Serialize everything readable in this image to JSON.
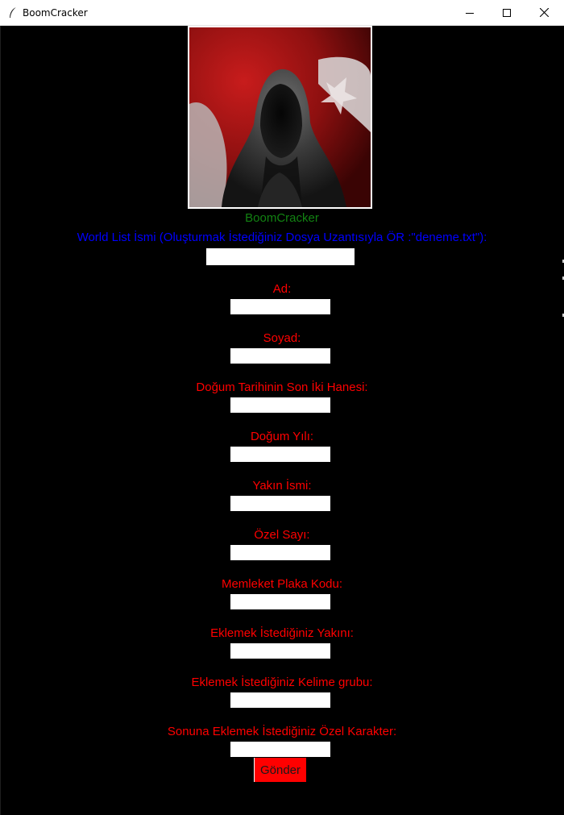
{
  "window": {
    "title": "BoomCracker",
    "icon": "feather-icon"
  },
  "app_name": "BoomCracker",
  "wordlist": {
    "label": "World List İsmi (Oluşturmak İstediğiniz Dosya Uzantısıyla ÖR :\"deneme.txt\"):",
    "value": ""
  },
  "fields": [
    {
      "label": "Ad:",
      "value": ""
    },
    {
      "label": "Soyad:",
      "value": ""
    },
    {
      "label": "Doğum Tarihinin Son İki Hanesi:",
      "value": ""
    },
    {
      "label": "Doğum Yılı:",
      "value": ""
    },
    {
      "label": "Yakın İsmi:",
      "value": ""
    },
    {
      "label": "Özel Sayı:",
      "value": ""
    },
    {
      "label": "Memleket Plaka Kodu:",
      "value": ""
    },
    {
      "label": "Eklemek İstediğiniz Yakını:",
      "value": ""
    },
    {
      "label": "Eklemek İstediğiniz Kelime grubu:",
      "value": ""
    },
    {
      "label": "Sonuna Eklemek İstediğiniz Özel Karakter:",
      "value": ""
    }
  ],
  "submit_label": "Gönder",
  "colors": {
    "background": "#000000",
    "app_name": "#128212",
    "wordlist_label": "#0000ff",
    "field_label": "#ff0000",
    "submit_bg": "#ff0000"
  }
}
